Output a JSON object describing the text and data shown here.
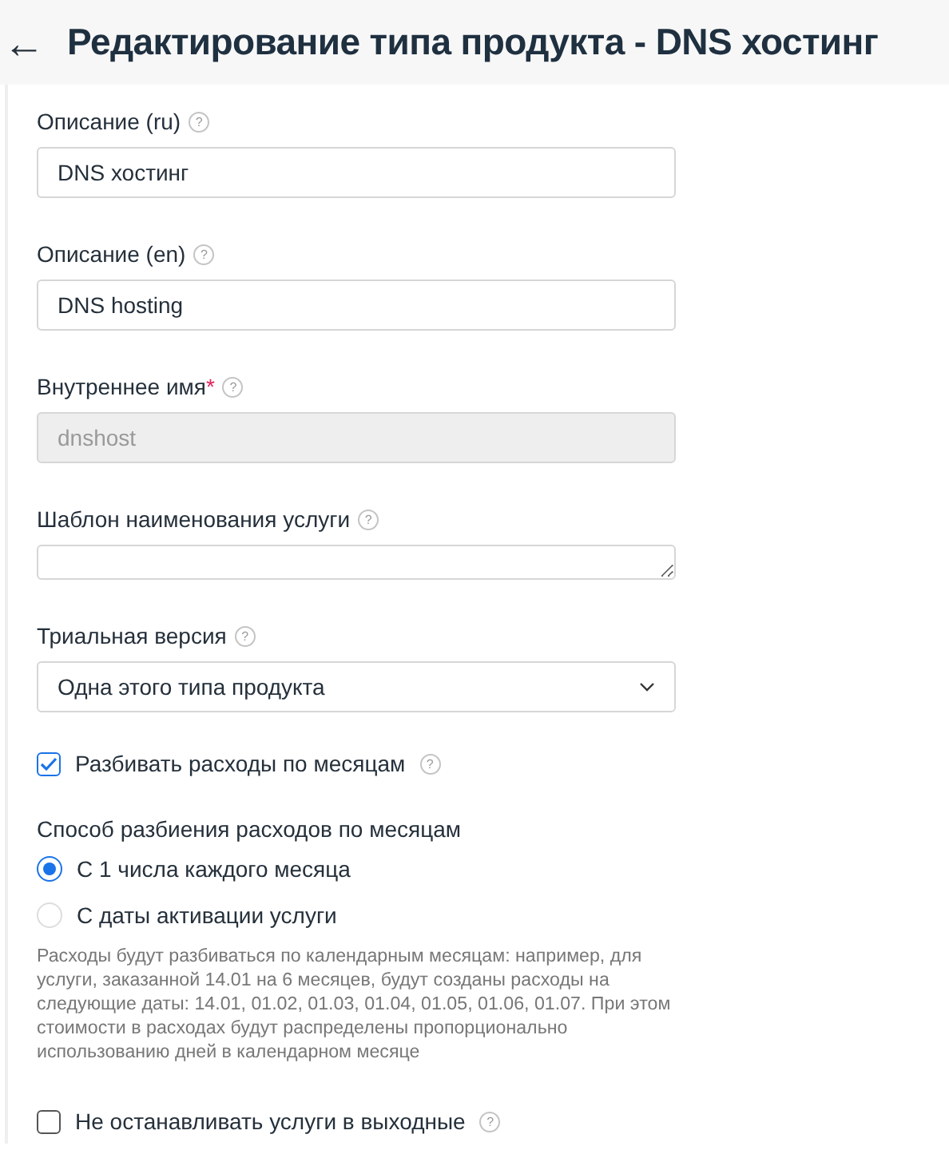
{
  "header": {
    "back": "←",
    "title": "Редактирование типа продукта - DNS хостинг"
  },
  "items": [
    {
      "kind": "text",
      "label": "Описание (ru)",
      "hint": "?",
      "value": "DNS хостинг",
      "disabled": false
    },
    {
      "kind": "text",
      "label": "Описание (en)",
      "hint": "?",
      "value": "DNS hosting",
      "disabled": false
    },
    {
      "kind": "text",
      "label": "Внутреннее имя",
      "required": "*",
      "hint": "?",
      "value": "dnshost",
      "disabled": true
    },
    {
      "kind": "textarea",
      "label": "Шаблон наименования услуги",
      "hint": "?"
    },
    {
      "kind": "select",
      "label": "Триальная версия",
      "hint": "?",
      "value": "Одна этого типа продукта"
    },
    {
      "kind": "checkbox",
      "label": "Разбивать расходы по месяцам",
      "hint": "?",
      "checked": true
    },
    {
      "kind": "radio",
      "label": "Способ разбиения расходов по месяцам",
      "options": [
        {
          "label": "С 1 числа каждого месяца",
          "selected": true
        },
        {
          "label": "С даты активации услуги",
          "selected": false
        }
      ],
      "note": "Расходы будут разбиваться по календарным месяцам: например, для услуги, заказанной 14.01 на 6 месяцев, будут созданы расходы на следующие даты: 14.01, 01.02, 01.03, 01.04, 01.05, 01.06, 01.07. При этом стоимости в расходах будут распределены пропорционально использованию дней в календарном месяце"
    },
    {
      "kind": "checkbox",
      "label": "Не останавливать услуги в выходные",
      "hint": "?",
      "checked": false
    }
  ]
}
